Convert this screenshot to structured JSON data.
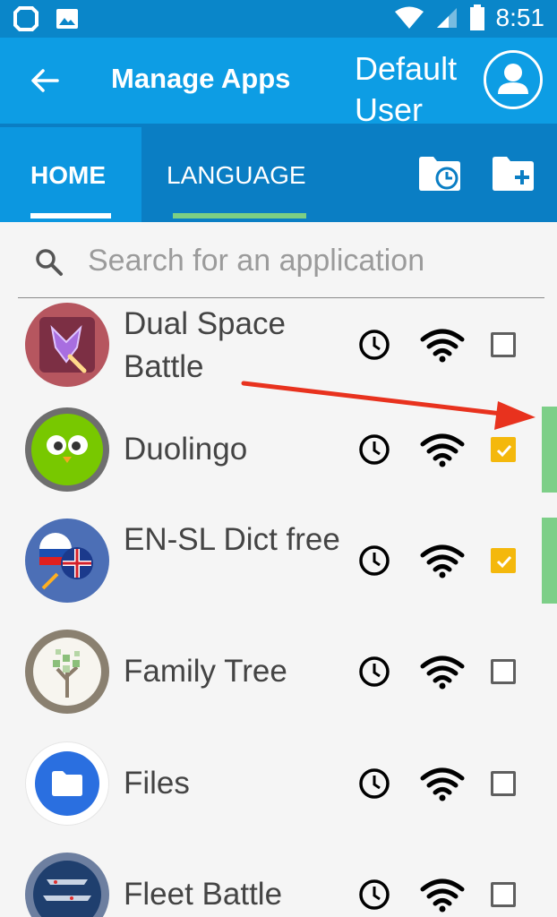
{
  "status_bar": {
    "time": "8:51"
  },
  "app_bar": {
    "title": "Manage Apps",
    "user_label": "Default User"
  },
  "tabs": [
    {
      "label": "HOME",
      "selected": true
    },
    {
      "label": "LANGUAGE",
      "selected": false
    }
  ],
  "search": {
    "placeholder": "Search for an application"
  },
  "apps": [
    {
      "name": "Dual Space Battle",
      "checked": false,
      "marked": false
    },
    {
      "name": "Duolingo",
      "checked": true,
      "marked": true
    },
    {
      "name": "EN-SL Dict free",
      "checked": true,
      "marked": true
    },
    {
      "name": "Family Tree",
      "checked": false,
      "marked": false
    },
    {
      "name": "Files",
      "checked": false,
      "marked": false
    },
    {
      "name": "Fleet Battle",
      "checked": false,
      "marked": false
    }
  ],
  "colors": {
    "status_bar": "#0a86c9",
    "app_bar": "#0d9de4",
    "tab_bar": "#0a7ec4",
    "checkbox_checked": "#f4b80c",
    "selection_marker": "#7dcf88",
    "annotation_arrow": "#e8321e"
  },
  "icons": {
    "status": [
      "app-notification-icon",
      "image-notification-icon",
      "wifi-icon",
      "signal-icon",
      "battery-icon"
    ],
    "toolbar": [
      "back-arrow-icon",
      "user-avatar-icon",
      "schedule-folder-icon",
      "add-folder-icon"
    ],
    "row": [
      "clock-icon",
      "wifi-icon",
      "checkbox"
    ]
  }
}
